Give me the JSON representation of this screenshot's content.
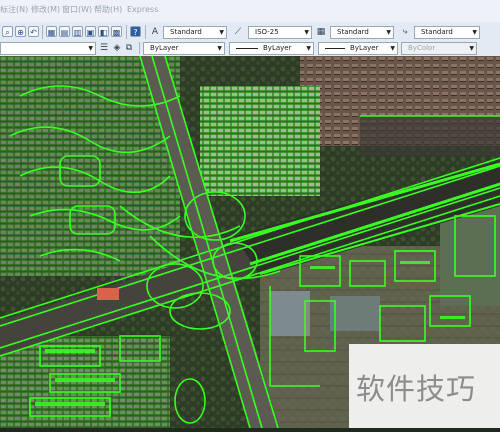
{
  "menu": {
    "items": [
      "标注(N)",
      "修改(M)",
      "窗口(W)",
      "帮助(H)",
      "Express"
    ]
  },
  "toolbar": {
    "text_style": "Standard",
    "dim_style": "ISO-25",
    "table_style": "Standard",
    "multileader_style": "Standard"
  },
  "properties": {
    "color": "ByLayer",
    "linetype": "ByLayer",
    "lineweight": "ByLayer",
    "plotstyle": "ByColor"
  },
  "watermark": {
    "text": "软件技巧"
  },
  "colors": {
    "cad_lines": "#39ff22",
    "toolbar": "#e4eaf3",
    "menubar": "#eef2f8"
  }
}
